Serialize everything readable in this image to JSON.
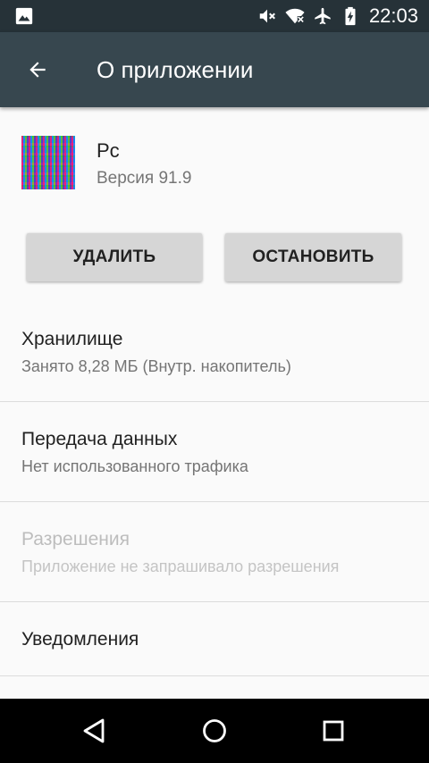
{
  "status_bar": {
    "time": "22:03",
    "icons": [
      "image-notification-icon",
      "mute-icon",
      "wifi-icon",
      "airplane-mode-icon",
      "battery-charging-icon"
    ]
  },
  "app_bar": {
    "title": "О приложении",
    "back_icon": "back-arrow-icon"
  },
  "app": {
    "name": "Pc",
    "version": "Версия 91.9"
  },
  "buttons": {
    "uninstall": "УДАЛИТЬ",
    "force_stop": "ОСТАНОВИТЬ"
  },
  "preferences": [
    {
      "title": "Хранилище",
      "summary": "Занято 8,28 МБ (Внутр. накопитель)",
      "enabled": true
    },
    {
      "title": "Передача данных",
      "summary": "Нет использованного трафика",
      "enabled": true
    },
    {
      "title": "Разрешения",
      "summary": "Приложение не запрашивало разрешения",
      "enabled": false
    },
    {
      "title": "Уведомления",
      "summary": "",
      "enabled": true
    }
  ],
  "nav_bar": {
    "icons": [
      "back-icon",
      "home-icon",
      "recents-icon"
    ]
  },
  "colors": {
    "status_bar": "#263238",
    "app_bar": "#37474f",
    "background": "#fafafa",
    "button": "#d6d6d6"
  }
}
